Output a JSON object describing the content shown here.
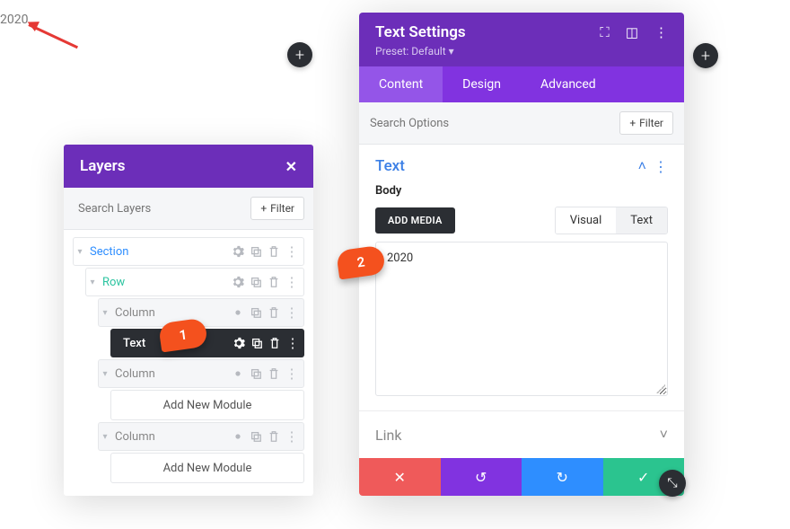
{
  "canvas": {
    "text": "2020"
  },
  "layers": {
    "title": "Layers",
    "search_placeholder": "Search Layers",
    "filter_label": "Filter",
    "tree": {
      "section": "Section",
      "row": "Row",
      "column": "Column",
      "textModule": "Text",
      "addModule": "Add New Module"
    }
  },
  "steps": {
    "one": "1",
    "two": "2"
  },
  "settings": {
    "title": "Text Settings",
    "preset": "Preset: Default",
    "tabs": {
      "content": "Content",
      "design": "Design",
      "advanced": "Advanced"
    },
    "search_placeholder": "Search Options",
    "filter_label": "Filter",
    "text_section": "Text",
    "body_label": "Body",
    "add_media": "ADD MEDIA",
    "editor_tabs": {
      "visual": "Visual",
      "text": "Text"
    },
    "editor_value": "2020",
    "link_section": "Link"
  },
  "icons": {
    "close": "✕",
    "plus": "+",
    "expand": "⛶",
    "columns": "◫",
    "more": "⋮",
    "chevron_up": "˄",
    "chevron_down": "˅",
    "caret_down": "▾",
    "caret_right": "▸",
    "undo": "↺",
    "redo": "↻",
    "check": "✓",
    "delete": "✕",
    "resize": "⤡"
  }
}
